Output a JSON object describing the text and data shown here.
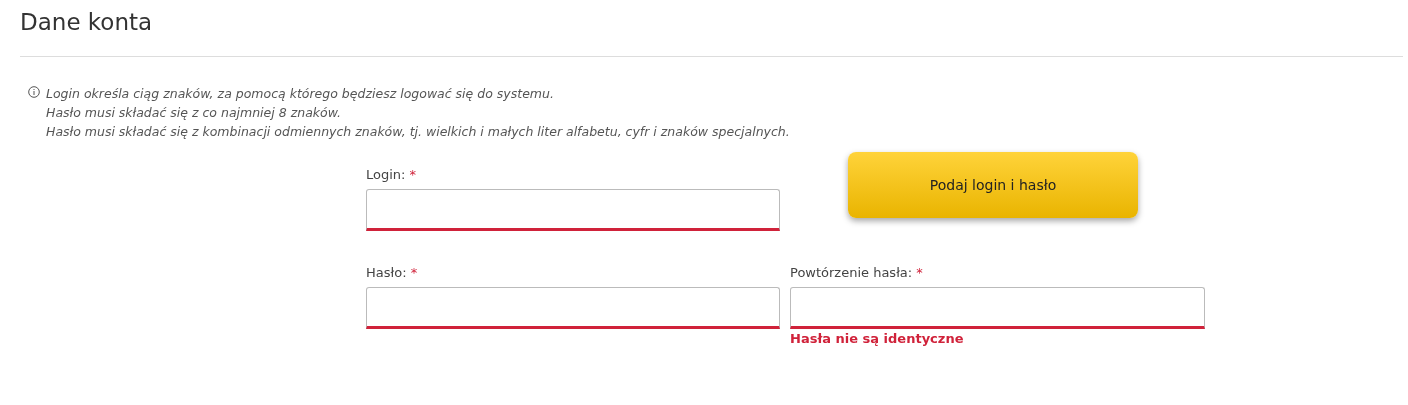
{
  "title": "Dane konta",
  "info": {
    "lines": [
      "Login określa ciąg znaków, za pomocą którego będziesz logować się do systemu.",
      "Hasło musi składać się z co najmniej 8 znaków.",
      "Hasło musi składać się z kombinacji odmiennych znaków, tj. wielkich i małych liter alfabetu, cyfr i znaków specjalnych."
    ]
  },
  "form": [
    {
      "kind": "field",
      "label": "Login:",
      "required_mark": "*",
      "invalid": true
    },
    {
      "kind": "button",
      "label": "Podaj login i hasło"
    },
    {
      "kind": "field",
      "label": "Hasło:",
      "required_mark": "*",
      "invalid": true
    },
    {
      "kind": "field",
      "label": "Powtórzenie hasła:",
      "required_mark": "*",
      "invalid": true,
      "error": "Hasła nie są identyczne"
    }
  ]
}
